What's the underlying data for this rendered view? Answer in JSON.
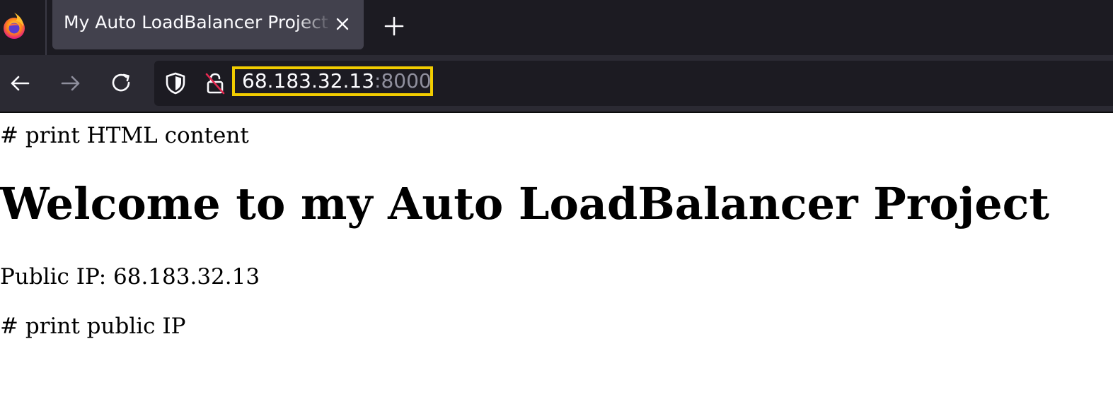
{
  "browser": {
    "tab": {
      "title": "My Auto LoadBalancer Project"
    },
    "address_bar": {
      "host": "68.183.32.13",
      "port": ":8000"
    },
    "icons": {
      "app": "firefox-icon",
      "close_tab": "close-icon",
      "new_tab": "plus-icon",
      "back": "arrow-left-icon",
      "forward": "arrow-right-icon",
      "reload": "reload-icon",
      "tracking_protection": "shield-icon",
      "connection_insecure": "lock-crossed-icon"
    },
    "colors": {
      "highlight_border": "#f2cd00",
      "tabstrip_bg": "#1c1b22",
      "navbar_bg": "#2b2a33",
      "insecure_slash": "#e22850"
    }
  },
  "page": {
    "comment_html": "# print HTML content",
    "heading": "Welcome to my Auto LoadBalancer Project",
    "public_ip_line": "Public IP: 68.183.32.13",
    "comment_ip": "# print public IP"
  }
}
